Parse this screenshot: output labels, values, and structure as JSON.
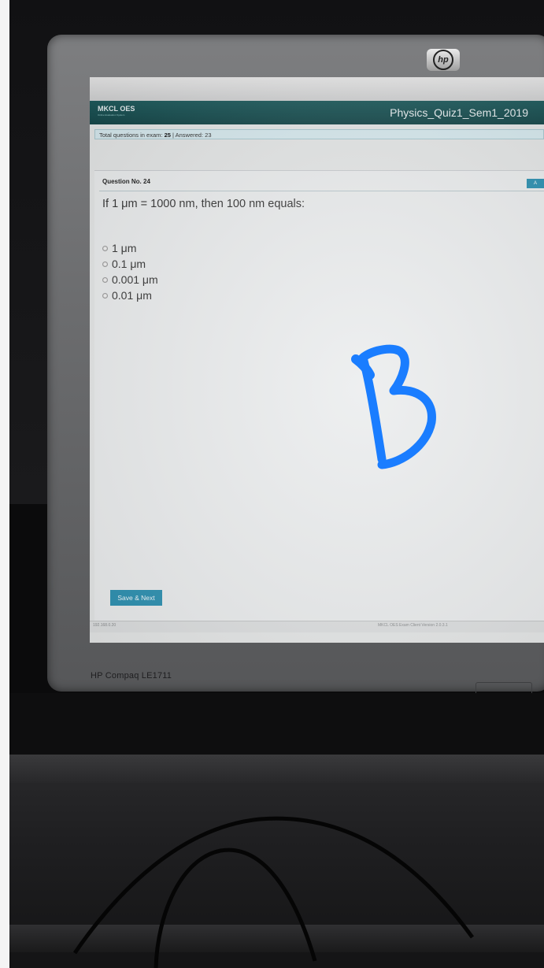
{
  "screen": {
    "app_name": "MKCL OES",
    "app_subtitle": "Online Evaluation System",
    "exam_title": "Physics_Quiz1_Sem1_2019",
    "info": {
      "total_label": "Total questions in exam:",
      "total": "25",
      "separator": "|",
      "answered_label": "Answered:",
      "answered": "23"
    },
    "question": {
      "number_label": "Question No. 24",
      "text": "If 1 μm = 1000 nm, then 100 nm equals:",
      "options": [
        "1 μm",
        "0.1 μm",
        "0.001 μm",
        "0.01 μm"
      ]
    },
    "corner_button": "A",
    "save_button": "Save & Next",
    "footer_ip": "192.168.0.20",
    "footer_version": "MKCL OES Exam Client Version 2.0.3.1"
  },
  "monitor": {
    "brand": "hp",
    "model": "HP Compaq LE1711"
  },
  "annotation": {
    "handwritten_letter": "B",
    "ink_color": "#1a7dff"
  }
}
